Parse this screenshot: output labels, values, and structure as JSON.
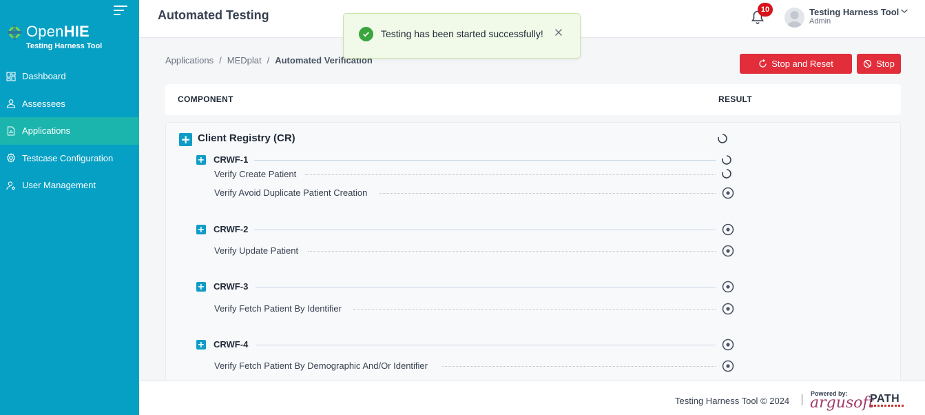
{
  "app": {
    "logo_text_light": "Open",
    "logo_text_bold": "HIE",
    "logo_subtitle": "Testing Harness Tool"
  },
  "sidebar": {
    "items": [
      {
        "label": "Dashboard",
        "icon": "dashboard-icon"
      },
      {
        "label": "Assessees",
        "icon": "user-icon"
      },
      {
        "label": "Applications",
        "icon": "document-icon",
        "active": true
      },
      {
        "label": "Testcase Configuration",
        "icon": "gear-icon"
      },
      {
        "label": "User Management",
        "icon": "user-settings-icon"
      }
    ]
  },
  "header": {
    "title": "Automated Testing",
    "notification_count": "10",
    "user_name": "Testing Harness Tool",
    "user_role": "Admin"
  },
  "toast": {
    "message": "Testing has been started successfully!"
  },
  "breadcrumb": {
    "items": [
      "Applications",
      "MEDplat",
      "Automated Verification"
    ],
    "separator": "/"
  },
  "actions": {
    "stop_reset_label": "Stop and Reset",
    "stop_label": "Stop"
  },
  "table": {
    "col_component": "COMPONENT",
    "col_result": "RESULT"
  },
  "component": {
    "title": "Client Registry (CR)",
    "status": "loading",
    "workflows": [
      {
        "name": "CRWF-1",
        "status": "loading",
        "tests": [
          {
            "name": "Verify Create Patient",
            "status": "loading"
          },
          {
            "name": "Verify Avoid Duplicate Patient Creation",
            "status": "pending"
          }
        ]
      },
      {
        "name": "CRWF-2",
        "status": "pending",
        "tests": [
          {
            "name": "Verify Update Patient",
            "status": "pending"
          }
        ]
      },
      {
        "name": "CRWF-3",
        "status": "pending",
        "tests": [
          {
            "name": "Verify Fetch Patient By Identifier",
            "status": "pending"
          }
        ]
      },
      {
        "name": "CRWF-4",
        "status": "pending",
        "tests": [
          {
            "name": "Verify Fetch Patient By Demographic And/Or Identifier",
            "status": "pending"
          }
        ]
      }
    ]
  },
  "footer": {
    "copyright": "Testing Harness Tool © 2024",
    "powered_by": "Powered by:",
    "argusoft": "argusoft",
    "path": "PATH"
  },
  "colors": {
    "sidebar": "#05a0c4",
    "active_item": "#1cb5ad",
    "danger": "#e22d3a",
    "accent": "#0f9cc6",
    "success": "#3aa53f"
  }
}
